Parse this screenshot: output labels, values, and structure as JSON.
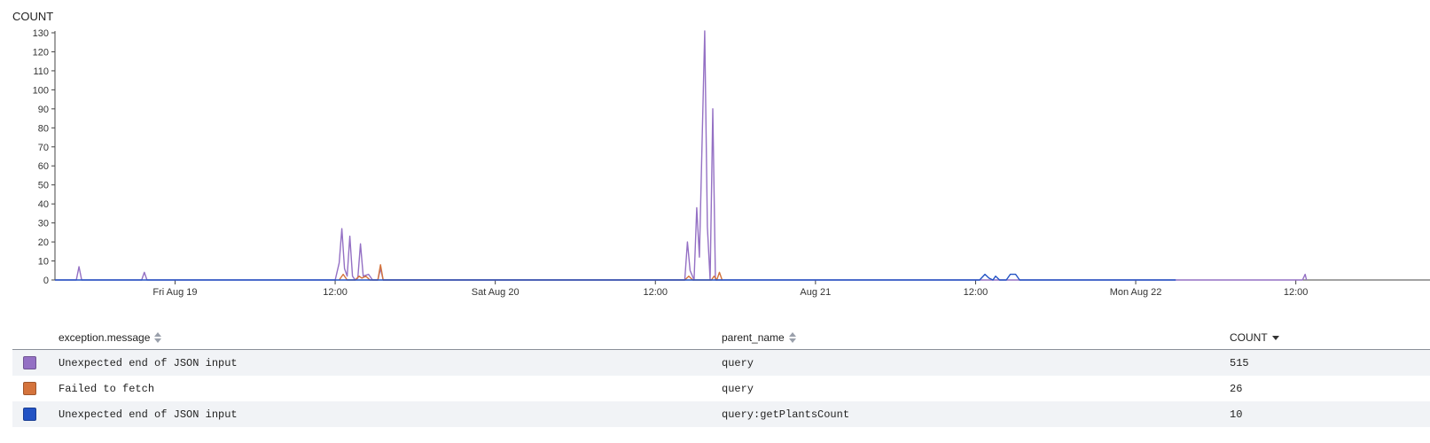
{
  "chart_data": {
    "type": "line",
    "ylabel": "COUNT",
    "ylim": [
      0,
      130
    ],
    "yticks": [
      0,
      10,
      20,
      30,
      40,
      50,
      60,
      70,
      80,
      90,
      100,
      110,
      120,
      130
    ],
    "x_range_hours": [
      0,
      84
    ],
    "x_ticks": [
      {
        "hour": 9,
        "label": "Fri Aug 19"
      },
      {
        "hour": 21,
        "label": "12:00"
      },
      {
        "hour": 33,
        "label": "Sat Aug 20"
      },
      {
        "hour": 45,
        "label": "12:00"
      },
      {
        "hour": 57,
        "label": "Aug 21"
      },
      {
        "hour": 69,
        "label": "12:00"
      },
      {
        "hour": 81,
        "label": "Mon Aug 22"
      },
      {
        "hour": 93,
        "label": "12:00"
      }
    ],
    "series": [
      {
        "name": "Unexpected end of JSON input",
        "color": "#9470c4",
        "points": [
          [
            0,
            0
          ],
          [
            1.6,
            0
          ],
          [
            1.8,
            7
          ],
          [
            2.0,
            0
          ],
          [
            6.5,
            0
          ],
          [
            6.7,
            4
          ],
          [
            6.9,
            0
          ],
          [
            21.0,
            0
          ],
          [
            21.3,
            9
          ],
          [
            21.5,
            27
          ],
          [
            21.7,
            6
          ],
          [
            21.9,
            2
          ],
          [
            22.1,
            23
          ],
          [
            22.3,
            2
          ],
          [
            22.5,
            0
          ],
          [
            22.7,
            1
          ],
          [
            22.9,
            19
          ],
          [
            23.1,
            2
          ],
          [
            23.5,
            3
          ],
          [
            23.8,
            0
          ],
          [
            24.2,
            0
          ],
          [
            24.4,
            6
          ],
          [
            24.6,
            0
          ],
          [
            47.2,
            0
          ],
          [
            47.4,
            20
          ],
          [
            47.6,
            5
          ],
          [
            47.9,
            0
          ],
          [
            48.1,
            38
          ],
          [
            48.3,
            12
          ],
          [
            48.7,
            131
          ],
          [
            48.9,
            28
          ],
          [
            49.1,
            0
          ],
          [
            49.3,
            90
          ],
          [
            49.5,
            0
          ],
          [
            93.5,
            0
          ],
          [
            93.7,
            3
          ],
          [
            93.8,
            0
          ]
        ]
      },
      {
        "name": "Failed to fetch",
        "color": "#d4733c",
        "points": [
          [
            21.3,
            0
          ],
          [
            21.6,
            3
          ],
          [
            21.9,
            0
          ],
          [
            22.5,
            0
          ],
          [
            22.8,
            2
          ],
          [
            23.0,
            1
          ],
          [
            23.3,
            2
          ],
          [
            23.6,
            0
          ],
          [
            24.2,
            0
          ],
          [
            24.4,
            8
          ],
          [
            24.6,
            0
          ],
          [
            47.2,
            0
          ],
          [
            47.5,
            2
          ],
          [
            47.8,
            0
          ],
          [
            49.2,
            0
          ],
          [
            49.4,
            2
          ],
          [
            49.6,
            0
          ],
          [
            49.8,
            4
          ],
          [
            50.0,
            0
          ]
        ]
      },
      {
        "name": "Unexpected end of JSON input",
        "color": "#2353c4",
        "points": [
          [
            0,
            0
          ],
          [
            69.3,
            0
          ],
          [
            69.7,
            3
          ],
          [
            70.0,
            1
          ],
          [
            70.3,
            0
          ],
          [
            70.5,
            2
          ],
          [
            70.8,
            0
          ],
          [
            71.3,
            0
          ],
          [
            71.6,
            3
          ],
          [
            72.0,
            3
          ],
          [
            72.3,
            0
          ],
          [
            84,
            0
          ]
        ]
      }
    ]
  },
  "table": {
    "headers": {
      "message": "exception.message",
      "parent": "parent_name",
      "count": "COUNT"
    },
    "rows": [
      {
        "color": "#9470c4",
        "message": "Unexpected end of JSON input",
        "parent": "query",
        "count": "515"
      },
      {
        "color": "#d4733c",
        "message": "Failed to fetch",
        "parent": "query",
        "count": "26"
      },
      {
        "color": "#2353c4",
        "message": "Unexpected end of JSON input",
        "parent": "query:getPlantsCount",
        "count": "10"
      }
    ]
  }
}
